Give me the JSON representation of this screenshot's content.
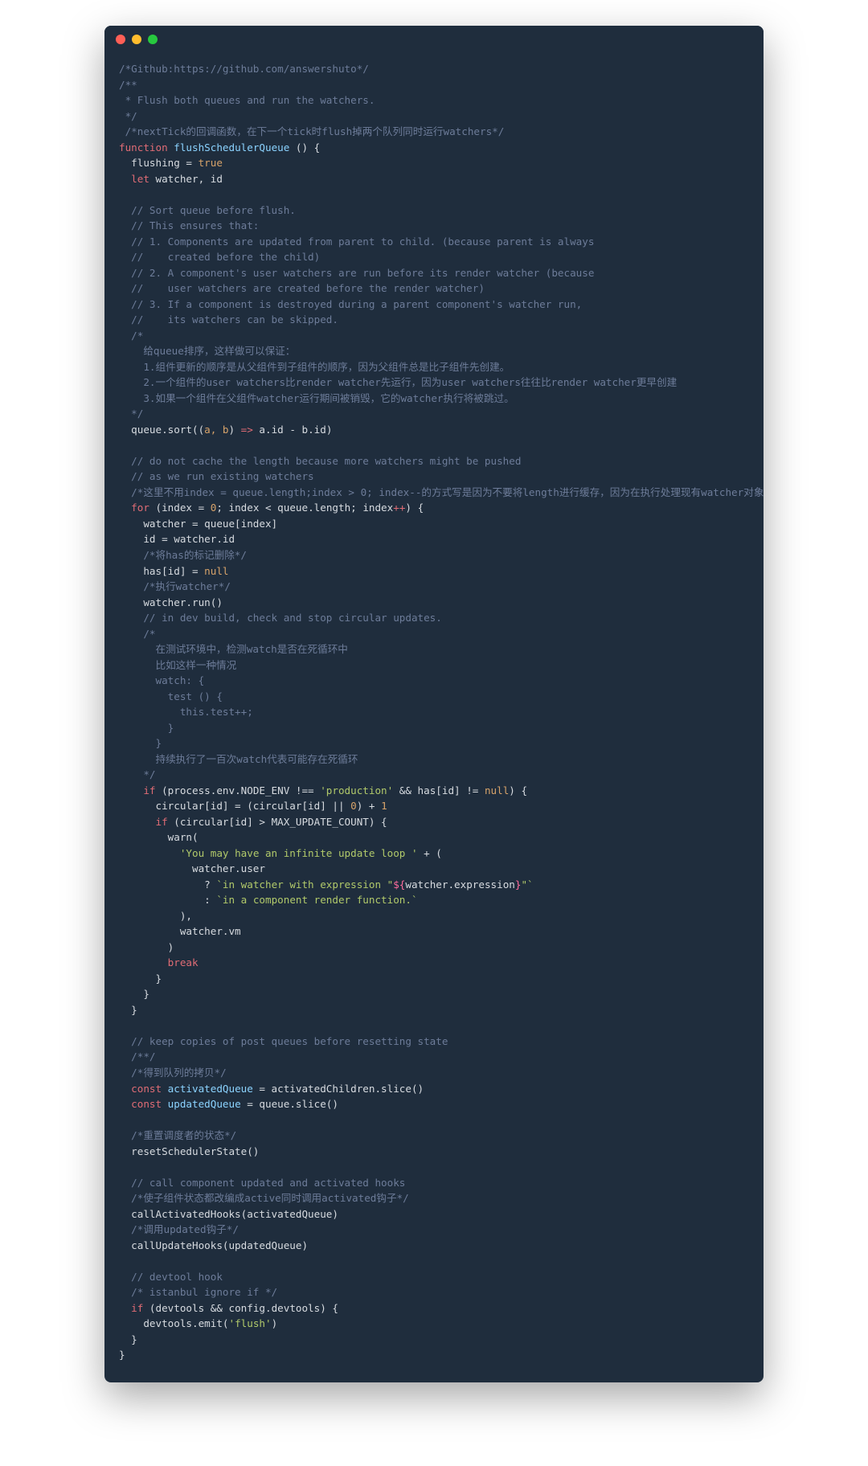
{
  "window": {
    "dot_colors": {
      "close": "#ff5f56",
      "min": "#ffbd2e",
      "max": "#27c93f"
    }
  },
  "code": {
    "l1": "/*Github:https://github.com/answershuto*/",
    "l2": "/**",
    "l3": " * Flush both queues and run the watchers.",
    "l4": " */",
    "l5": " /*nextTick的回调函数，在下一个tick时flush掉两个队列同时运行watchers*/",
    "l6a": "function",
    "l6b": " flushSchedulerQueue",
    "l6c": " ()",
    "l6d": " {",
    "l7a": "  flushing = ",
    "l7b": "true",
    "l8a": "  let",
    "l8b": " watcher, id",
    "blank9": "",
    "l10": "  // Sort queue before flush.",
    "l11": "  // This ensures that:",
    "l12": "  // 1. Components are updated from parent to child. (because parent is always",
    "l13": "  //    created before the child)",
    "l14": "  // 2. A component's user watchers are run before its render watcher (because",
    "l15": "  //    user watchers are created before the render watcher)",
    "l16": "  // 3. If a component is destroyed during a parent component's watcher run,",
    "l17": "  //    its watchers can be skipped.",
    "l18": "  /*",
    "l19": "    给queue排序，这样做可以保证：",
    "l20": "    1.组件更新的顺序是从父组件到子组件的顺序，因为父组件总是比子组件先创建。",
    "l21": "    2.一个组件的user watchers比render watcher先运行，因为user watchers往往比render watcher更早创建",
    "l22": "    3.如果一个组件在父组件watcher运行期间被销毁，它的watcher执行将被跳过。",
    "l23": "  */",
    "l24a": "  queue.sort((",
    "l24b": "a, b",
    "l24c": ") ",
    "l24d": "=>",
    "l24e": " a.id - b.id)",
    "blank25": "",
    "l26": "  // do not cache the length because more watchers might be pushed",
    "l27": "  // as we run existing watchers",
    "l28": "  /*这里不用index = queue.length;index > 0; index--的方式写是因为不要将length进行缓存，因为在执行处理现有watcher对象期间，更多的watcher对象可能会被push进queue*/",
    "l29a": "  for",
    "l29b": " (index = ",
    "l29c": "0",
    "l29d": "; index < queue.length; index",
    "l29e": "++",
    "l29f": ") {",
    "l30": "    watcher = queue[index]",
    "l31": "    id = watcher.id",
    "l32": "    /*将has的标记删除*/",
    "l33a": "    has[id] = ",
    "l33b": "null",
    "l34": "    /*执行watcher*/",
    "l35": "    watcher.run()",
    "l36": "    // in dev build, check and stop circular updates.",
    "l37": "    /*",
    "l38": "      在测试环境中，检测watch是否在死循环中",
    "l39": "      比如这样一种情况",
    "l40": "      watch: {",
    "l41": "        test () {",
    "l42": "          this.test++;",
    "l43": "        }",
    "l44": "      }",
    "l45": "      持续执行了一百次watch代表可能存在死循环",
    "l46": "    */",
    "l47a": "    if",
    "l47b": " (process.env.NODE_ENV !== ",
    "l47c": "'production'",
    "l47d": " && has[id] != ",
    "l47e": "null",
    "l47f": ") {",
    "l48a": "      circular[id] = (circular[id] || ",
    "l48b": "0",
    "l48c": ") + ",
    "l48d": "1",
    "l49a": "      if",
    "l49b": " (circular[id] > MAX_UPDATE_COUNT) {",
    "l50": "        warn(",
    "l51a": "          ",
    "l51b": "'You may have an infinite update loop '",
    "l51c": " + (",
    "l52": "            watcher.user",
    "l53a": "              ? ",
    "l53b": "`in watcher with expression \"",
    "l53c": "${",
    "l53d": "watcher.expression",
    "l53e": "}",
    "l53f": "\"`",
    "l54a": "              : ",
    "l54b": "`in a component render function.`",
    "l55": "          ),",
    "l56": "          watcher.vm",
    "l57": "        )",
    "l58a": "        ",
    "l58b": "break",
    "l59": "      }",
    "l60": "    }",
    "l61": "  }",
    "blank62": "",
    "l63": "  // keep copies of post queues before resetting state",
    "l64": "  /**/",
    "l65": "  /*得到队列的拷贝*/",
    "l66a": "  const",
    "l66b": " activatedQueue",
    "l66c": " = activatedChildren.slice()",
    "l67a": "  const",
    "l67b": " updatedQueue",
    "l67c": " = queue.slice()",
    "blank68": "",
    "l69": "  /*重置调度者的状态*/",
    "l70": "  resetSchedulerState()",
    "blank71": "",
    "l72": "  // call component updated and activated hooks",
    "l73": "  /*使子组件状态都改编成active同时调用activated钩子*/",
    "l74": "  callActivatedHooks(activatedQueue)",
    "l75": "  /*调用updated钩子*/",
    "l76": "  callUpdateHooks(updatedQueue)",
    "blank77": "",
    "l78": "  // devtool hook",
    "l79": "  /* istanbul ignore if */",
    "l80a": "  if",
    "l80b": " (devtools && config.devtools) {",
    "l81a": "    devtools.emit(",
    "l81b": "'flush'",
    "l81c": ")",
    "l82": "  }",
    "l83": "}"
  }
}
